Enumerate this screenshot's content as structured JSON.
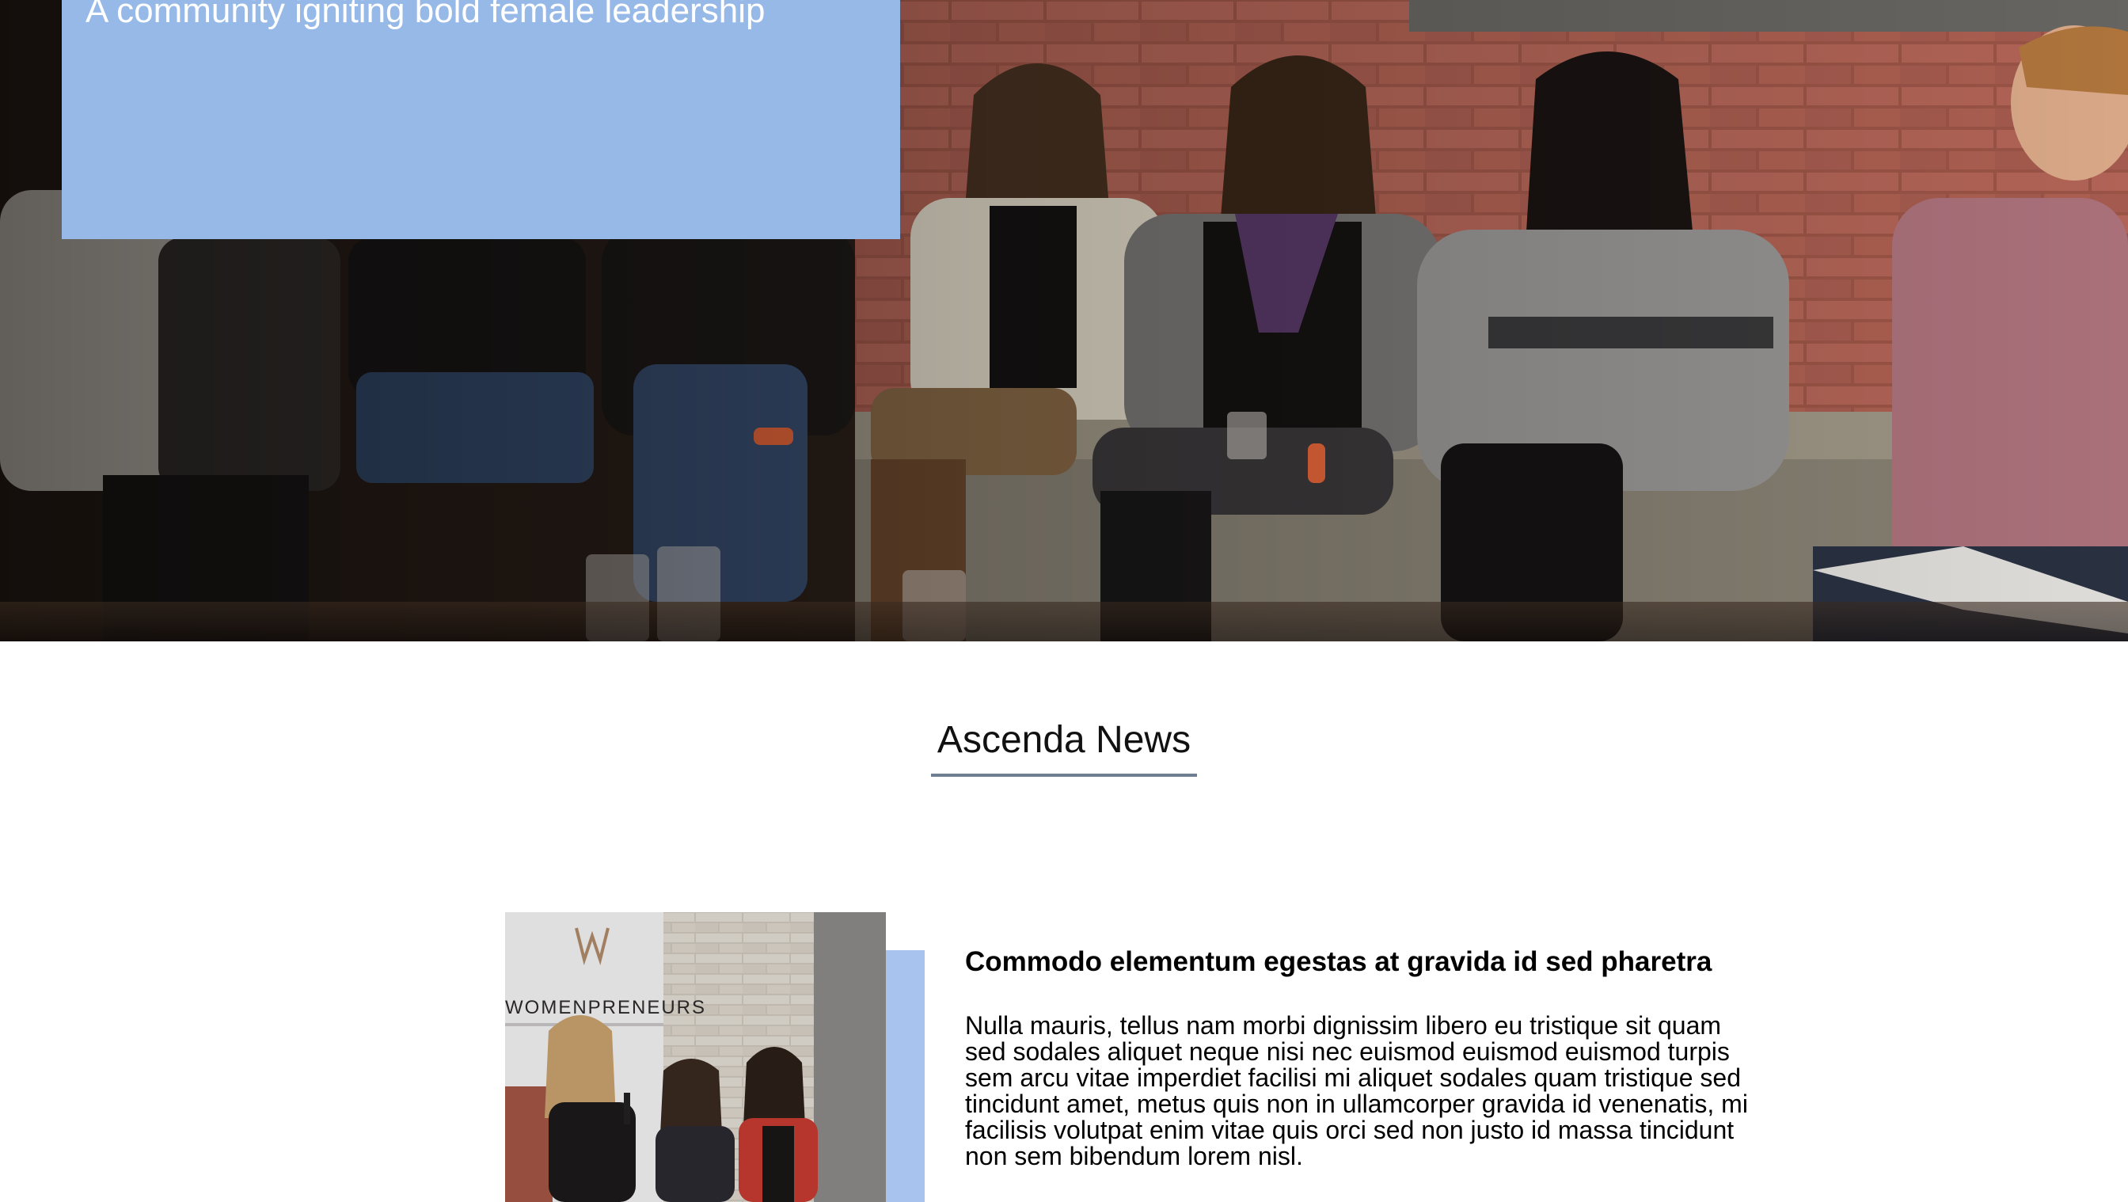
{
  "hero": {
    "tagline": "A community igniting bold female leadership",
    "card_color": "#97b9e8",
    "photo_alt": "Group of people seated on a couch talking in front of a brick wall"
  },
  "news": {
    "heading": "Ascenda News",
    "underline_color": "#6e7f91"
  },
  "article": {
    "title": "Commodo elementum egestas at gravida id sed pharetra",
    "body": "Nulla mauris, tellus nam morbi dignissim libero eu tristique sit quam sed sodales aliquet neque nisi nec euismod euismod euismod turpis sem arcu vitae imperdiet facilisi mi aliquet sodales quam tristique sed tincidunt amet, metus quis non in ullamcorper gravida id venenatis, mi facilisis volutpat enim vitae quis orci sed non justo id massa tincidunt non sem bibendum lorem nisl.",
    "photo_banner_text": "WOMENPRENEURS",
    "photo_alt": "Three women on stage in front of a Womenpreneurs banner",
    "accent_color": "#a8c4ee"
  }
}
